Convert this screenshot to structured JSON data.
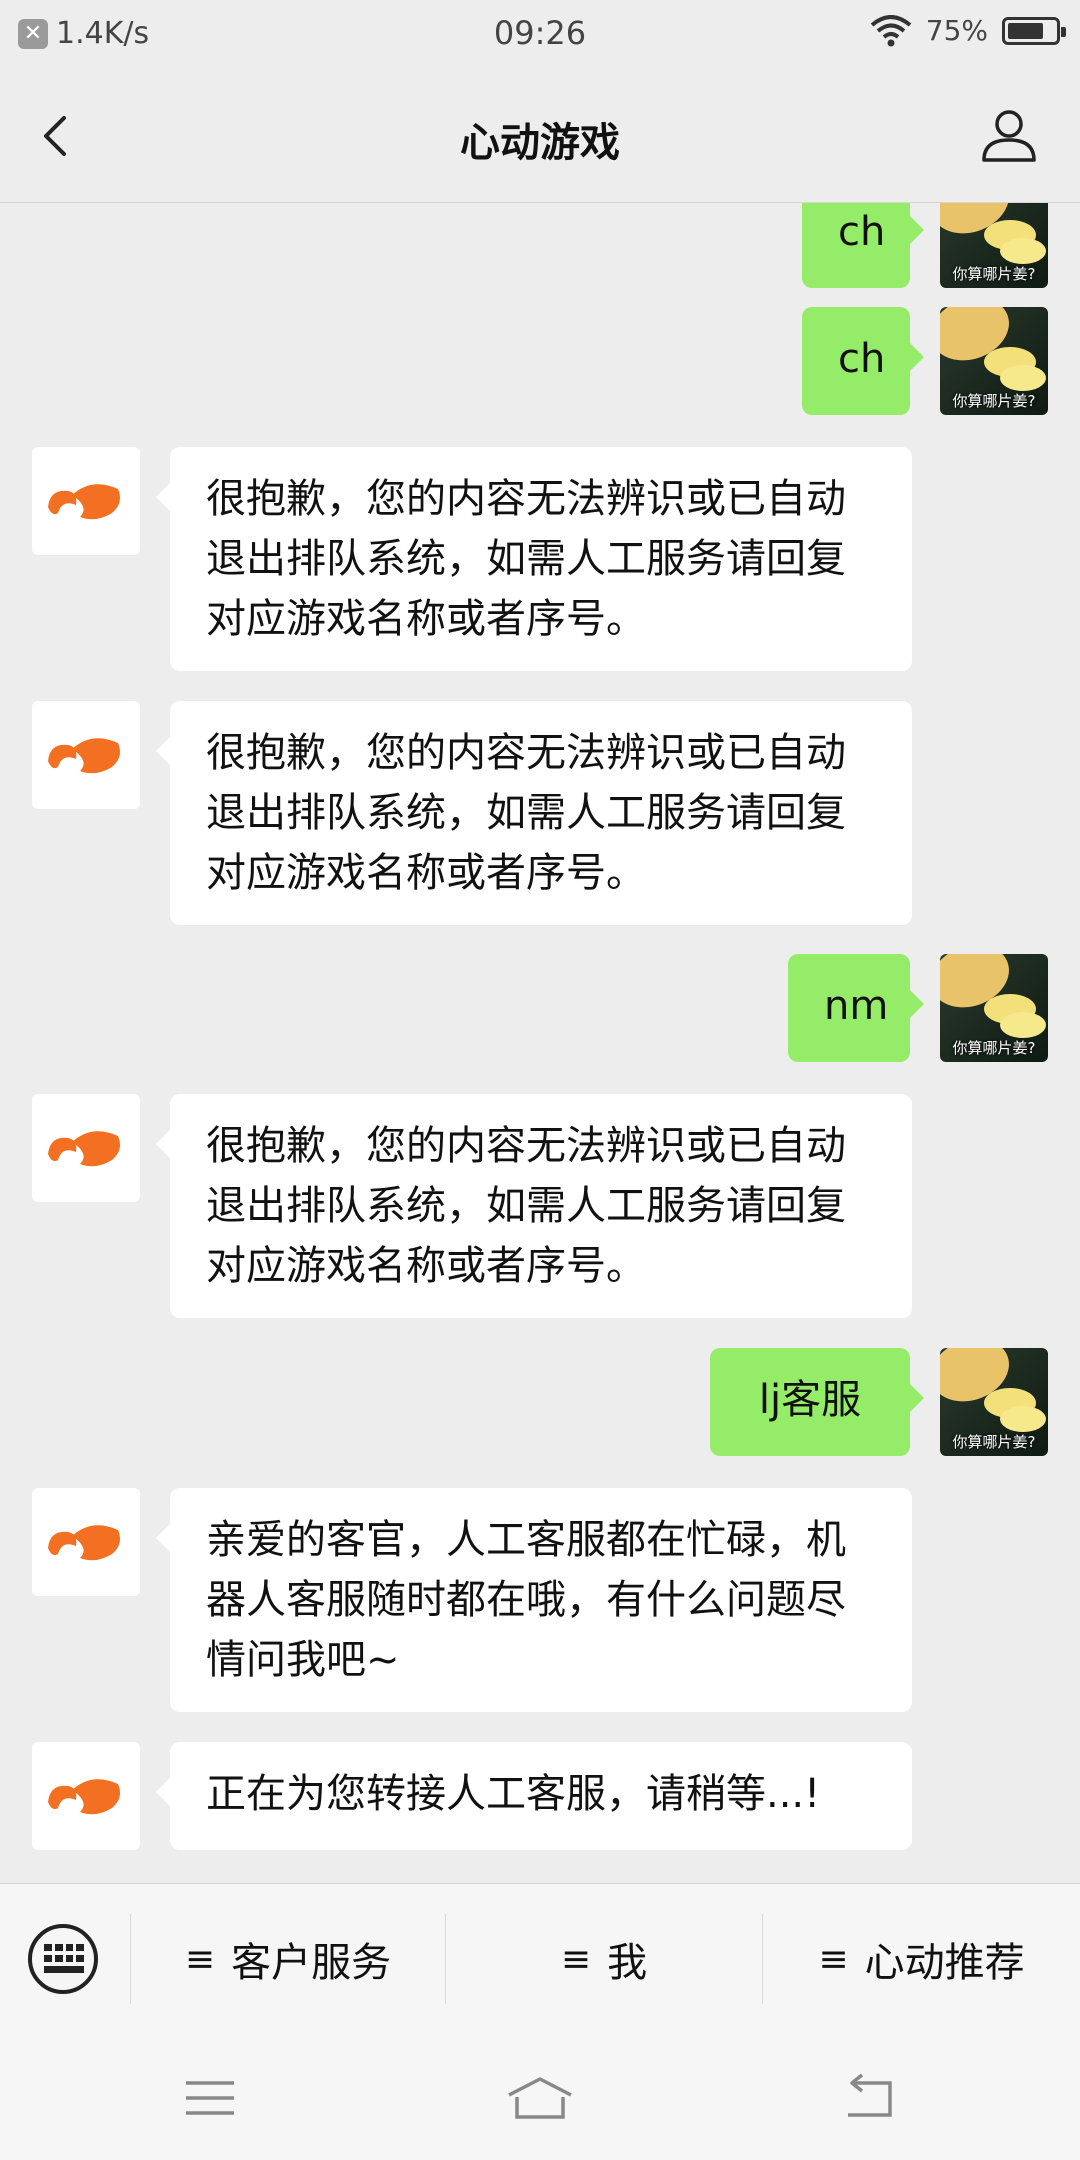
{
  "status_bar": {
    "net_speed": "1.4K/s",
    "time": "09:26",
    "battery": "75%",
    "battery_level": 0.75
  },
  "header": {
    "title": "心动游戏"
  },
  "messages": [
    {
      "from": "user",
      "text": "ch",
      "avatar_caption": "你算哪片姜?"
    },
    {
      "from": "user",
      "text": "ch",
      "avatar_caption": "你算哪片姜?"
    },
    {
      "from": "bot",
      "text": "很抱歉，您的内容无法辨识或已自动退出排队系统，如需人工服务请回复对应游戏名称或者序号。"
    },
    {
      "from": "bot",
      "text": "很抱歉，您的内容无法辨识或已自动退出排队系统，如需人工服务请回复对应游戏名称或者序号。"
    },
    {
      "from": "user",
      "text": "nm",
      "avatar_caption": "你算哪片姜?"
    },
    {
      "from": "bot",
      "text": "很抱歉，您的内容无法辨识或已自动退出排队系统，如需人工服务请回复对应游戏名称或者序号。"
    },
    {
      "from": "user",
      "text": "lj客服",
      "avatar_caption": "你算哪片姜?"
    },
    {
      "from": "bot",
      "text": "亲爱的客官，人工客服都在忙碌，机器人客服随时都在哦，有什么问题尽情问我吧~"
    },
    {
      "from": "bot",
      "text": "正在为您转接人工客服，请稍等...!"
    }
  ],
  "menu": {
    "items": [
      {
        "icon": "≡",
        "label": "客户服务"
      },
      {
        "icon": "≡",
        "label": "我"
      },
      {
        "icon": "≡",
        "label": "心动推荐"
      }
    ]
  },
  "colors": {
    "user_bubble": "#95ec69",
    "bot_avatar": "#f36f21",
    "background": "#ededed"
  }
}
